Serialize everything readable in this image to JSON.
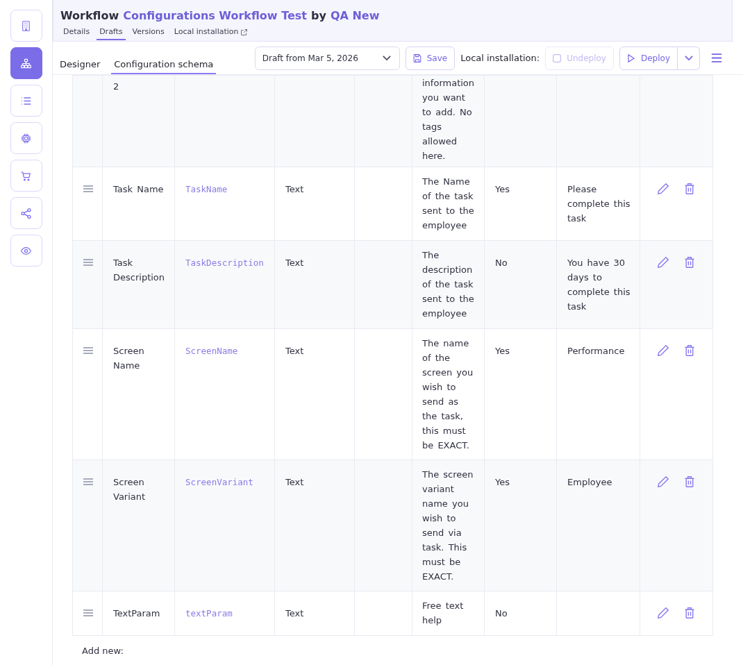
{
  "sidebar": {
    "items": [
      {
        "selected": false
      },
      {
        "selected": true
      },
      {
        "selected": false
      },
      {
        "selected": false
      },
      {
        "selected": false
      },
      {
        "selected": false
      },
      {
        "selected": false
      }
    ]
  },
  "header": {
    "title": {
      "prefix": "Workflow",
      "workflow_link": "Configurations Workflow Test",
      "by": "by",
      "owner_link": "QA New"
    },
    "tabs": [
      {
        "label": "Details",
        "selected": false,
        "external": false
      },
      {
        "label": "Drafts",
        "selected": true,
        "external": false
      },
      {
        "label": "Versions",
        "selected": false,
        "external": false
      },
      {
        "label": "Local installation",
        "selected": false,
        "external": true
      }
    ]
  },
  "toolbar": {
    "view_tabs": [
      {
        "label": "Designer",
        "selected": false
      },
      {
        "label": "Configuration schema",
        "selected": true
      }
    ],
    "draft_select": {
      "value": "Draft from Mar 5, 2026"
    },
    "save_button": {
      "label": "Save"
    },
    "local_installation_label": "Local installation:",
    "undeploy_button": {
      "label": "Undeploy",
      "disabled": true
    },
    "deploy_button": {
      "label": "Deploy",
      "disabled": false
    }
  },
  "table": {
    "rows": [
      {
        "kind": "clipped",
        "column_2": "2",
        "column_6": "information you want to add. No tags allowed here."
      },
      {
        "kind": "item",
        "column_2": "Task Name",
        "column_3": "TaskName",
        "column_4": "Text",
        "column_6": "The Name of the task sent to the employee",
        "column_7": "Yes",
        "column_8": "Please complete this task"
      },
      {
        "kind": "item",
        "column_2": "Task Description",
        "column_3": "TaskDescription",
        "column_4": "Text",
        "column_6": "The description of the task sent to the employee",
        "column_7": "No",
        "column_8": "You have 30 days to complete this task"
      },
      {
        "kind": "item",
        "column_2": "Screen Name",
        "column_3": "ScreenName",
        "column_4": "Text",
        "column_6": "The name of the screen you wish to send as the task, this must be EXACT.",
        "column_7": "Yes",
        "column_8": "Performance"
      },
      {
        "kind": "item",
        "column_2": "Screen Variant",
        "column_3": "ScreenVariant",
        "column_4": "Text",
        "column_6": "The screen variant name you wish to send via task. This must be EXACT.",
        "column_7": "Yes",
        "column_8": "Employee"
      },
      {
        "kind": "item",
        "column_2": "TextParam",
        "column_3": "textParam",
        "column_4": "Text",
        "column_6": "Free text help",
        "column_7": "No"
      }
    ]
  },
  "add_new_label": "Add new:"
}
